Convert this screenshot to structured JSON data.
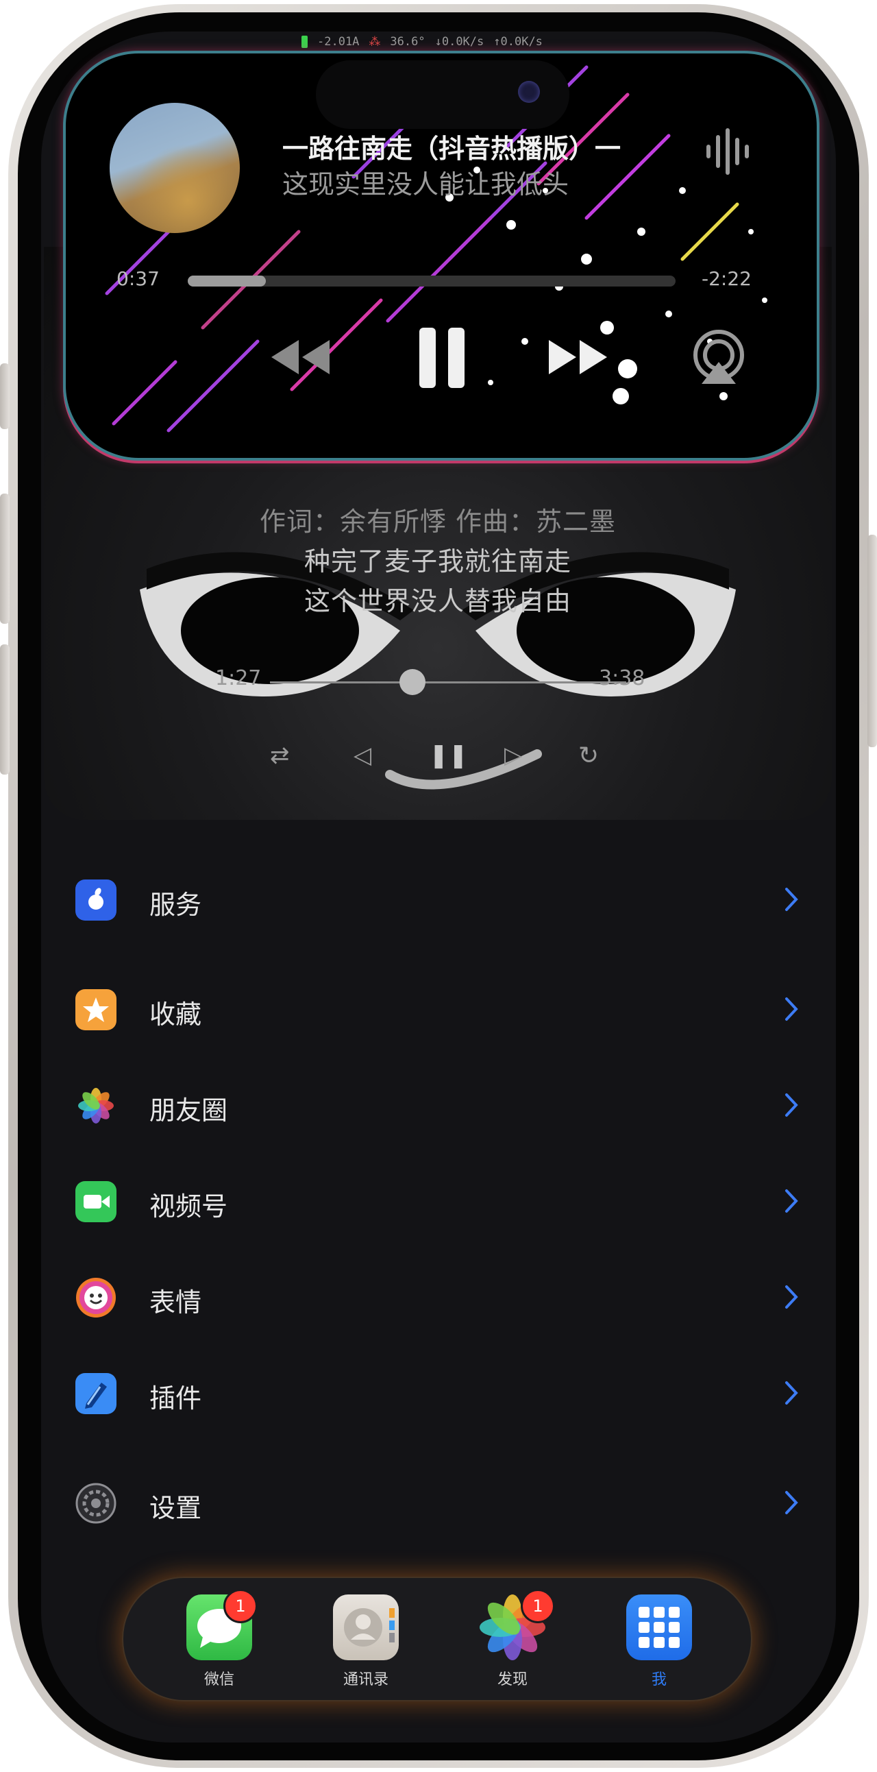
{
  "status_bar": {
    "current": "-2.01A",
    "temp": "36.6°",
    "down": "↓0.0K/s",
    "up": "↑0.0K/s"
  },
  "music": {
    "title": "一路往南走（抖音热播版）一",
    "lyric_line": "这现实里没人能让我低头",
    "elapsed": "0:37",
    "remaining": "-2:22",
    "progress": 0.16,
    "icons": {
      "prev": "rewind-icon",
      "play_pause": "pause-icon",
      "next": "fast-forward-icon",
      "output": "airplay-icon",
      "waveform": "waveform-icon"
    }
  },
  "lyrics": {
    "credits": "作词：余有所悸  作曲：苏二墨",
    "line1": "种完了麦子我就往南走",
    "line2": "这个世界没人替我自由",
    "elapsed": "1:27",
    "total": "3:38",
    "progress": 0.4
  },
  "menu": [
    {
      "label": "服务",
      "icon": "apple-icon",
      "color": "#2f62e8"
    },
    {
      "label": "收藏",
      "icon": "star-icon",
      "color": "#f6a23b"
    },
    {
      "label": "朋友圈",
      "icon": "photos-flower-icon",
      "color": "#ffffff"
    },
    {
      "label": "视频号",
      "icon": "video-camera-icon",
      "color": "#34c759"
    },
    {
      "label": "表情",
      "icon": "emoji-face-icon",
      "color": "#e2489c"
    },
    {
      "label": "插件",
      "icon": "puzzle-pencil-icon",
      "color": "#3a8cf5"
    },
    {
      "label": "设置",
      "icon": "gear-icon",
      "color": "#8e8e93"
    }
  ],
  "dock": [
    {
      "label": "微信",
      "badge": "1",
      "icon": "messages-icon"
    },
    {
      "label": "通讯录",
      "badge": "",
      "icon": "contacts-icon"
    },
    {
      "label": "发现",
      "badge": "1",
      "icon": "photos-icon"
    },
    {
      "label": "我",
      "badge": "",
      "icon": "apps-grid-icon",
      "active_color": "#2f7cf6"
    }
  ]
}
